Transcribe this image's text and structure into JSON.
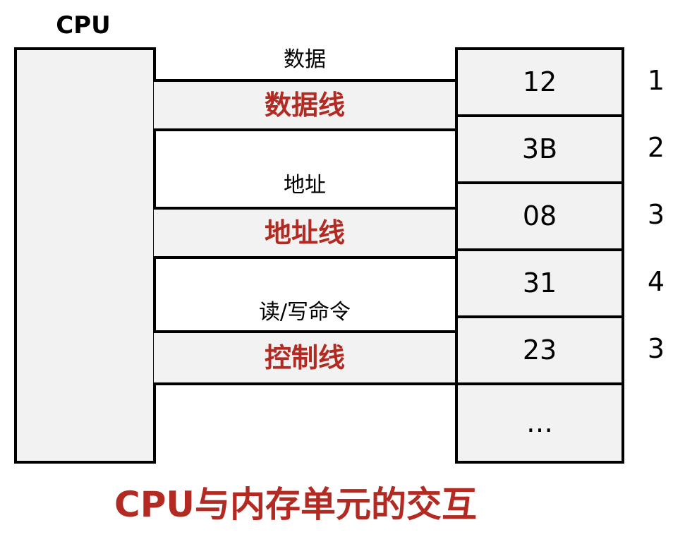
{
  "cpu": {
    "title": "CPU"
  },
  "buses": [
    {
      "signal": "数据",
      "name": "数据线"
    },
    {
      "signal": "地址",
      "name": "地址线"
    },
    {
      "signal": "读/写命令",
      "name": "控制线"
    }
  ],
  "memory": {
    "cells": [
      {
        "value": "12",
        "address": "1"
      },
      {
        "value": "3B",
        "address": "2"
      },
      {
        "value": "08",
        "address": "3"
      },
      {
        "value": "31",
        "address": "4"
      },
      {
        "value": "23",
        "address": "3"
      },
      {
        "value": "…",
        "address": ""
      }
    ]
  },
  "caption": "CPU与内存单元的交互",
  "colors": {
    "accent": "#b22a22",
    "fill": "#f2f2f2",
    "stroke": "#000000"
  }
}
